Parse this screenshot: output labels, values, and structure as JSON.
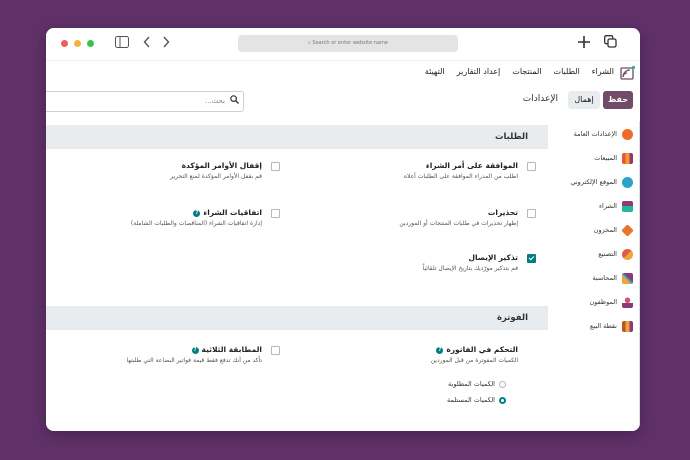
{
  "browser": {
    "url_placeholder": "Search or enter website name"
  },
  "navbar": {
    "menu": [
      "الشراء",
      "الطلبات",
      "المنتجات",
      "إعداد التقارير",
      "التهيئة"
    ]
  },
  "actionbar": {
    "save_label": "حفظ",
    "discard_label": "إهمال",
    "title": "الإعدادات",
    "search_placeholder": "بحث..."
  },
  "sidebar": {
    "items": [
      {
        "label": "الإعدادات العامة",
        "color": "#f06b2a",
        "icon": "general-settings-icon"
      },
      {
        "label": "المبيعات",
        "color": "#e8553d",
        "icon": "sales-icon"
      },
      {
        "label": "الموقع الإلكتروني",
        "color": "#2aa3c9",
        "icon": "website-icon"
      },
      {
        "label": "الشراء",
        "color": "#8a3a7a",
        "icon": "purchase-icon"
      },
      {
        "label": "المخزون",
        "color": "#e8762d",
        "icon": "inventory-icon"
      },
      {
        "label": "التصنيع",
        "color": "#e35a4b",
        "icon": "manufacturing-icon"
      },
      {
        "label": "المحاسبة",
        "color": "#f2a33a",
        "icon": "accounting-icon"
      },
      {
        "label": "الموظفون",
        "color": "#d94f7a",
        "icon": "employees-icon"
      },
      {
        "label": "نقطة البيع",
        "color": "#b8562a",
        "icon": "pos-icon"
      }
    ]
  },
  "sections": {
    "orders": {
      "title": "الطلبات",
      "po_approval": {
        "title": "الموافقة على أمر الشراء",
        "desc": "اطلب من المدراء الموافقة على الطلبات أعلاه"
      },
      "lock_orders": {
        "title": "إقفال الأوامر المؤكدة",
        "desc": "قم بقفل الأوامر المؤكدة لمنع التحرير"
      },
      "warnings": {
        "title": "تحذيرات",
        "desc": "إظهار تحذيرات في طلبات المنتجات أو الموردين"
      },
      "agreements": {
        "title": "اتفاقيات الشراء",
        "desc": "إدارة اتفاقيات الشراء (المناقصات والطلبات الشاملة)"
      },
      "receipt_reminder": {
        "title": "تذكير الإيصال",
        "desc": "قم بتذكير مورّديك بتاريخ الإيصال تلقائياً"
      }
    },
    "invoicing": {
      "title": "الفوترة",
      "bill_control": {
        "title": "التحكم في الفاتورة",
        "desc": "الكميات المفوترة من قبل الموردين"
      },
      "three_way": {
        "title": "المطابقة الثلاثية",
        "desc": "تأكد من أنك تدفع فقط قيمة فواتير البضاعة التي طلبتها"
      },
      "options": [
        {
          "label": "الكميات المطلوبة",
          "selected": false
        },
        {
          "label": "الكميات المستلمة",
          "selected": true
        }
      ]
    }
  },
  "help_glyph": "?"
}
